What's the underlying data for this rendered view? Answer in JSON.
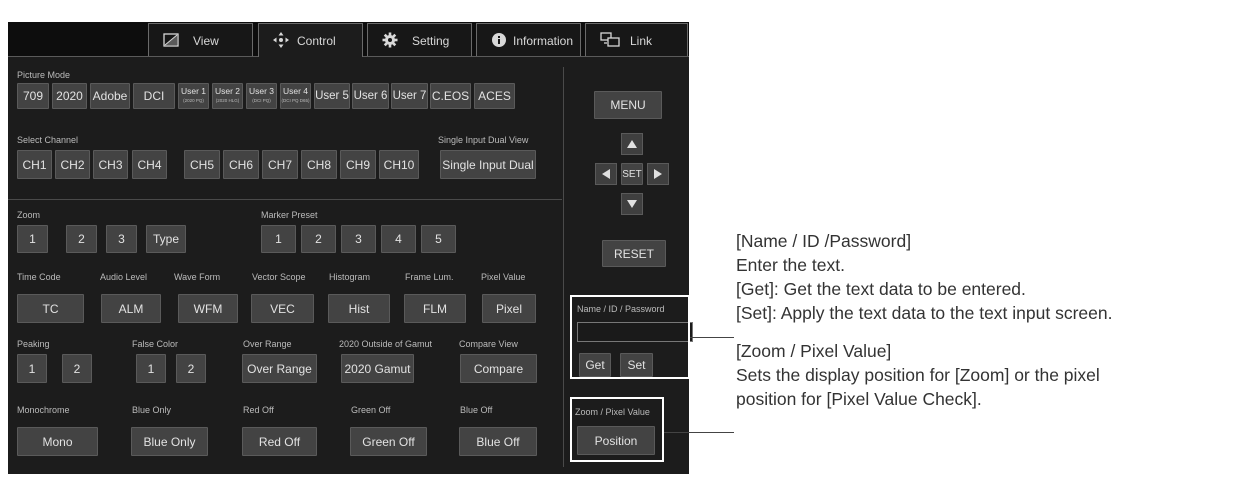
{
  "tabs": [
    {
      "label": "View",
      "icon": "view-icon"
    },
    {
      "label": "Control",
      "icon": "move-arrows-icon"
    },
    {
      "label": "Setting",
      "icon": "gear-icon"
    },
    {
      "label": "Information",
      "icon": "info-icon"
    },
    {
      "label": "Link",
      "icon": "monitors-icon"
    }
  ],
  "picture_mode": {
    "label": "Picture Mode",
    "buttons": [
      "709",
      "2020",
      "Adobe",
      "DCI",
      "User 5",
      "User 6",
      "User 7",
      "C.EOS",
      "ACES"
    ],
    "user_buttons": [
      {
        "label": "User 1",
        "sub": "(2020 PQ)"
      },
      {
        "label": "User 2",
        "sub": "(2020 HLG)"
      },
      {
        "label": "User 3",
        "sub": "(DCI PQ)"
      },
      {
        "label": "User 4",
        "sub": "(DCI PQ D65)"
      }
    ]
  },
  "select_channel": {
    "label": "Select Channel",
    "channels": [
      "CH1",
      "CH2",
      "CH3",
      "CH4",
      "CH5",
      "CH6",
      "CH7",
      "CH8",
      "CH9",
      "CH10"
    ],
    "single_input_label": "Single Input Dual View",
    "single_input_button": "Single Input Dual"
  },
  "zoom": {
    "label": "Zoom",
    "buttons": [
      "1",
      "2",
      "3",
      "Type"
    ]
  },
  "marker_preset": {
    "label": "Marker Preset",
    "buttons": [
      "1",
      "2",
      "3",
      "4",
      "5"
    ]
  },
  "scopes": {
    "labels": [
      "Time Code",
      "Audio Level",
      "Wave Form",
      "Vector Scope",
      "Histogram",
      "Frame Lum.",
      "Pixel Value"
    ],
    "buttons": [
      "TC",
      "ALM",
      "WFM",
      "VEC",
      "Hist",
      "FLM",
      "Pixel"
    ]
  },
  "peaking": {
    "label": "Peaking",
    "buttons": [
      "1",
      "2"
    ]
  },
  "false_color": {
    "label": "False Color",
    "buttons": [
      "1",
      "2"
    ]
  },
  "over_range": {
    "label": "Over Range",
    "button": "Over Range"
  },
  "gamut": {
    "label": "2020 Outside of Gamut",
    "button": "2020 Gamut"
  },
  "compare": {
    "label": "Compare View",
    "button": "Compare"
  },
  "monochrome": {
    "label": "Monochrome",
    "button": "Mono"
  },
  "blue_only": {
    "label": "Blue Only",
    "button": "Blue Only"
  },
  "red_off": {
    "label": "Red Off",
    "button": "Red Off"
  },
  "green_off": {
    "label": "Green Off",
    "button": "Green Off"
  },
  "blue_off": {
    "label": "Blue Off",
    "button": "Blue Off"
  },
  "right_panel": {
    "menu": "MENU",
    "set": "SET",
    "reset": "RESET",
    "name_label": "Name / ID / Password",
    "get": "Get",
    "set_button": "Set",
    "zoom_pixel_label": "Zoom / Pixel Value",
    "position": "Position"
  },
  "annotations": {
    "name_title": "[Name / ID /Password]",
    "name_line1": "Enter the text.",
    "name_line2": "[Get]: Get the text data to be entered.",
    "name_line3": "[Set]: Apply the text data to the text input screen.",
    "zoom_title": "[Zoom / Pixel Value]",
    "zoom_line1": "Sets the display position for [Zoom] or the pixel",
    "zoom_line2": "position for [Pixel Value Check]."
  }
}
